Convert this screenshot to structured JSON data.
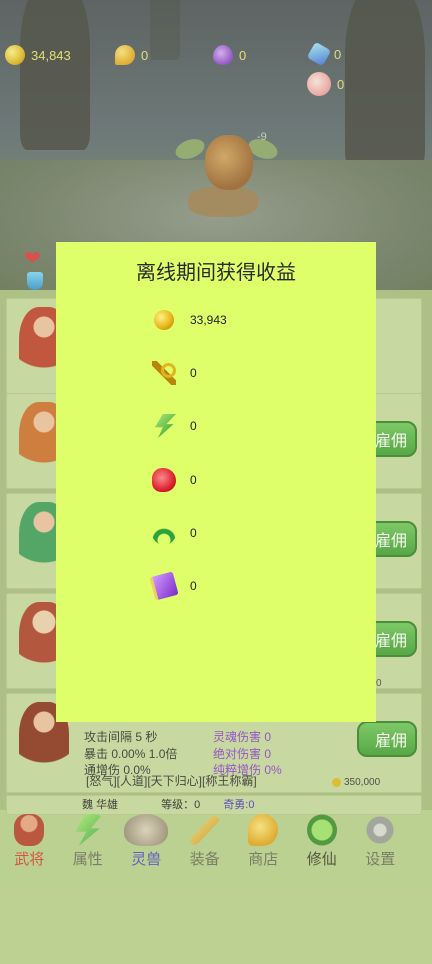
{
  "top_resources": {
    "gold": "34,843",
    "mango": "0",
    "potion": "0",
    "gem": "0",
    "peach": "0"
  },
  "battle": {
    "damage_text": "-9"
  },
  "dialog": {
    "title": "离线期间获得收益",
    "rewards": [
      {
        "icon": "gold-coin-icon",
        "value": "33,943"
      },
      {
        "icon": "key-icon",
        "value": "0"
      },
      {
        "icon": "lightning-icon",
        "value": "0"
      },
      {
        "icon": "boxing-glove-icon",
        "value": "0"
      },
      {
        "icon": "laurel-icon",
        "value": "0"
      },
      {
        "icon": "purple-book-icon",
        "value": "0"
      }
    ]
  },
  "hero_list": {
    "hire_label": "雇佣",
    "hero5": {
      "attack_interval": "攻击间隔   5 秒",
      "crit": "暴击  0.00%  1.0倍",
      "dmg_bonus": "通增伤   0.0%",
      "soul_damage": "灵魂伤害 0",
      "absolute_damage": "绝对伤害 0",
      "pure_damage_bonus": "纯粹增伤 0%",
      "skills": "[怒气][人道][天下归心][称王称霸]",
      "cost": "350,000"
    },
    "hero6": {
      "name": "魏 华雄",
      "level": "等级：0",
      "brave": "奇勇:0"
    },
    "side_value": "0"
  },
  "nav": {
    "items": [
      {
        "label": "武将",
        "icon": "general-icon"
      },
      {
        "label": "属性",
        "icon": "lightning-icon"
      },
      {
        "label": "灵兽",
        "icon": "beast-icon"
      },
      {
        "label": "装备",
        "icon": "sword-icon"
      },
      {
        "label": "商店",
        "icon": "mango-icon"
      },
      {
        "label": "修仙",
        "icon": "cultivation-icon"
      },
      {
        "label": "设置",
        "icon": "gear-icon"
      }
    ]
  },
  "colors": {
    "dialog_bg": "#dfff6a",
    "hire_button": "#4fae3e",
    "gold_text": "#e9de6f"
  }
}
